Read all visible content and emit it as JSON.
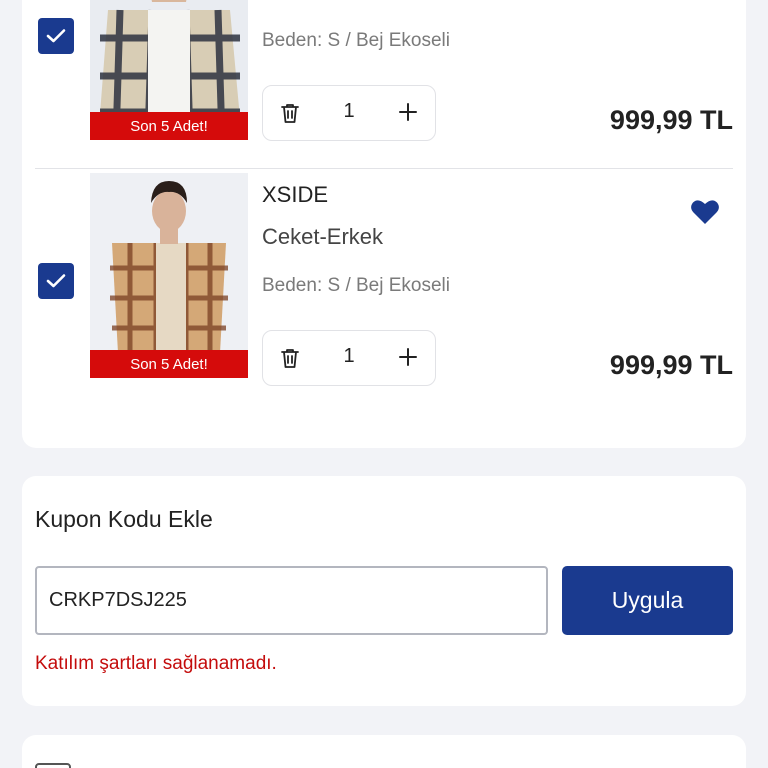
{
  "colors": {
    "accent": "#1a3a8f",
    "badge": "#d50b0b",
    "error": "#c40c0c",
    "background": "#f2f3f7"
  },
  "cart": {
    "items": [
      {
        "checked": true,
        "stock_badge": "Son 5 Adet!",
        "variant": "Beden: S / Bej Ekoseli",
        "quantity": "1",
        "price": "999,99 TL",
        "icons": [
          "check-icon",
          "trash-icon",
          "plus-icon"
        ]
      },
      {
        "checked": true,
        "brand": "XSIDE",
        "name": "Ceket-Erkek",
        "stock_badge": "Son 5 Adet!",
        "variant": "Beden: S / Bej Ekoseli",
        "quantity": "1",
        "price": "999,99 TL",
        "favorite": true,
        "icons": [
          "check-icon",
          "trash-icon",
          "plus-icon",
          "heart-icon"
        ]
      }
    ]
  },
  "coupon": {
    "title": "Kupon Kodu Ekle",
    "code": "CRKP7DSJ225",
    "apply_label": "Uygula",
    "error": "Katılım şartları sağlanamadı."
  }
}
